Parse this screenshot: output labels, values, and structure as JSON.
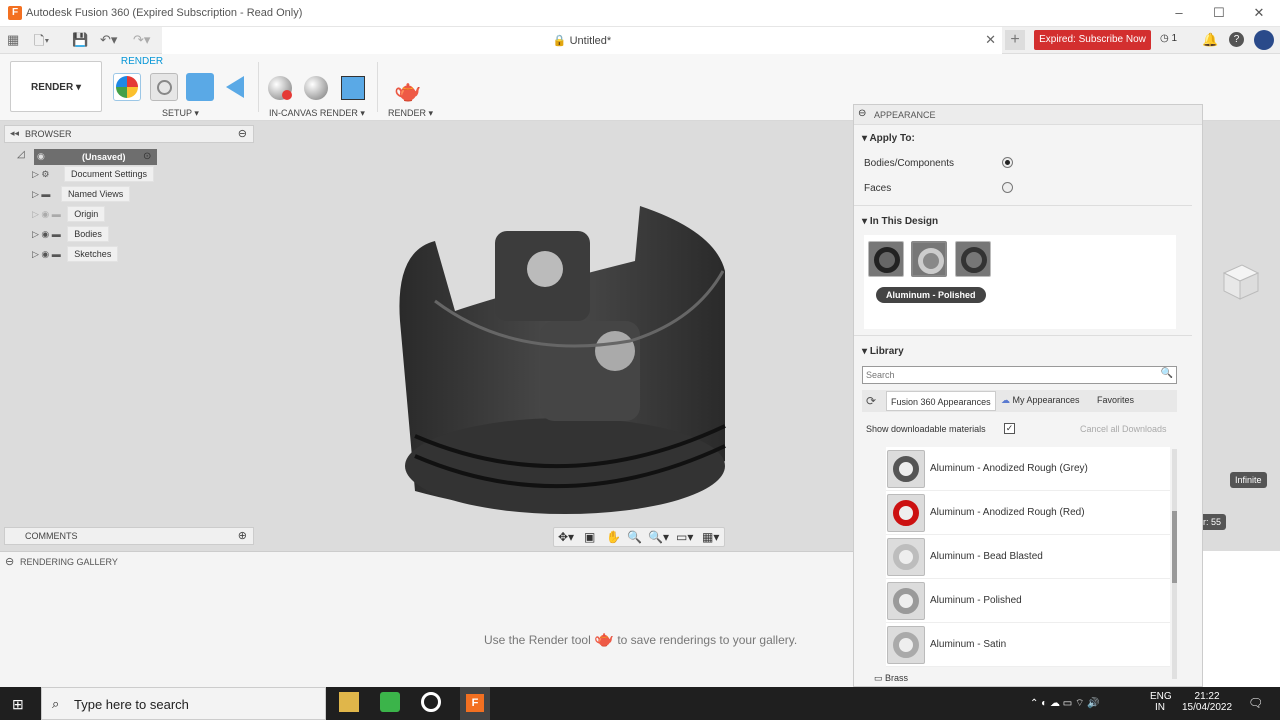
{
  "window": {
    "title": "Autodesk Fusion 360 (Expired Subscription - Read Only)",
    "logo": "F"
  },
  "tabs": {
    "doc_title": "Untitled*",
    "expired_label": "Expired: Subscribe Now",
    "jobs_count": "1"
  },
  "toolbar": {
    "workspace": "RENDER",
    "active_tab": "RENDER",
    "groups": [
      "SETUP",
      "IN-CANVAS RENDER",
      "RENDER"
    ]
  },
  "browser": {
    "header": "BROWSER",
    "root": "(Unsaved)",
    "items": [
      "Document Settings",
      "Named Views",
      "Origin",
      "Bodies",
      "Sketches"
    ]
  },
  "comments": {
    "header": "COMMENTS"
  },
  "gallery": {
    "header": "RENDERING GALLERY",
    "message_before": "Use the Render tool",
    "message_after": "to save renderings to your gallery."
  },
  "appearance": {
    "header": "APPEARANCE",
    "apply_to": {
      "title": "Apply To:",
      "options": [
        "Bodies/Components",
        "Faces"
      ],
      "selected": "Bodies/Components"
    },
    "in_design": {
      "title": "In This Design",
      "tooltip": "Aluminum - Polished"
    },
    "library": {
      "title": "Library",
      "search_placeholder": "Search",
      "tabs": [
        "Fusion 360 Appearances",
        "My Appearances",
        "Favorites"
      ],
      "show_downloadable": "Show downloadable materials",
      "cancel_downloads": "Cancel all Downloads",
      "materials": [
        {
          "name": "Aluminum - Anodized Rough (Grey)",
          "color": "#555555"
        },
        {
          "name": "Aluminum - Anodized Rough (Red)",
          "color": "#cc1111"
        },
        {
          "name": "Aluminum - Bead Blasted",
          "color": "#bdbdbd"
        },
        {
          "name": "Aluminum - Polished",
          "color": "#9a9a9a"
        },
        {
          "name": "Aluminum - Satin",
          "color": "#aaaaaa"
        }
      ],
      "folder": "Brass"
    }
  },
  "side_labels": {
    "infinite": "Infinite",
    "value": "r: 55"
  },
  "taskbar": {
    "search_placeholder": "Type here to search",
    "lang1": "ENG",
    "lang2": "IN",
    "time": "21:22",
    "date": "15/04/2022"
  }
}
